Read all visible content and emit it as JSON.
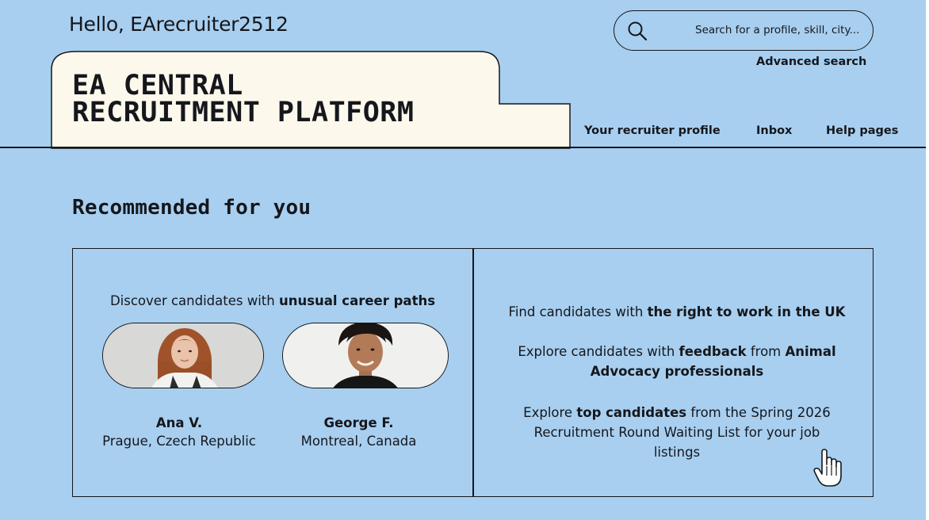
{
  "header": {
    "greeting": "Hello, EArecruiter2512",
    "search_placeholder": "Search for a profile, skill, city...",
    "advanced_search": "Advanced search"
  },
  "title": {
    "line1": "EA CENTRAL",
    "line2": "RECRUITMENT PLATFORM"
  },
  "nav": {
    "items": [
      {
        "label": "Your recruiter profile"
      },
      {
        "label": "Inbox"
      },
      {
        "label": "Help pages"
      }
    ]
  },
  "recommended": {
    "heading": "Recommended for you",
    "left": {
      "prefix": "Discover candidates with ",
      "bold": "unusual career paths",
      "candidates": [
        {
          "name": "Ana V.",
          "location": "Prague, Czech Republic"
        },
        {
          "name": "George F.",
          "location": "Montreal, Canada"
        }
      ]
    },
    "right": {
      "item1": {
        "prefix": "Find candidates with ",
        "bold": "the right to work in the UK"
      },
      "item2": {
        "prefix": "Explore candidates with ",
        "bold1": "feedback",
        "middle": " from ",
        "bold2": "Animal Advocacy professionals"
      },
      "item3": {
        "prefix": "Explore ",
        "bold": "top candidates",
        "suffix": " from the Spring 2026 Recruitment Round Waiting List for your job listings"
      }
    }
  },
  "colors": {
    "background": "#a8cff0",
    "tab_fill": "#fcf8ec",
    "ink": "#15171c"
  },
  "icons": [
    "search-icon",
    "hand-pointer-cursor-icon"
  ]
}
